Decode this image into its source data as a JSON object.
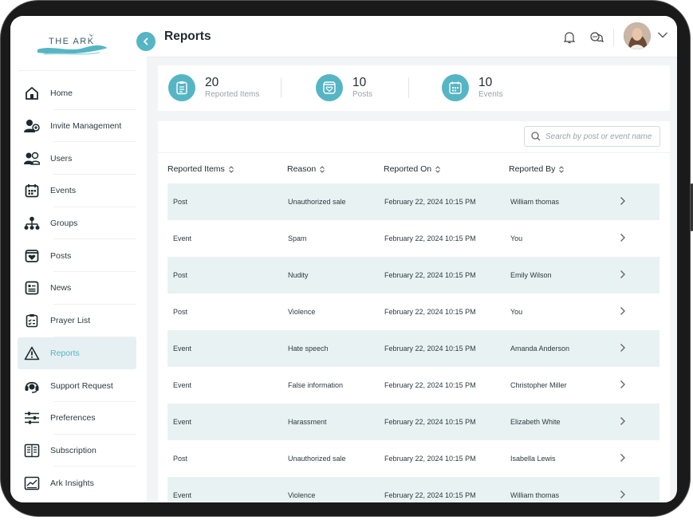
{
  "brand": {
    "logo_text": "THE ARK"
  },
  "sidebar": {
    "items": [
      {
        "label": "Home",
        "icon": "home-icon"
      },
      {
        "label": "Invite Management",
        "icon": "invite-user-icon"
      },
      {
        "label": "Users",
        "icon": "users-icon"
      },
      {
        "label": "Events",
        "icon": "calendar-icon"
      },
      {
        "label": "Groups",
        "icon": "groups-icon"
      },
      {
        "label": "Posts",
        "icon": "post-heart-icon"
      },
      {
        "label": "News",
        "icon": "news-icon"
      },
      {
        "label": "Prayer List",
        "icon": "clipboard-list-icon"
      },
      {
        "label": "Reports",
        "icon": "warning-icon",
        "active": true
      },
      {
        "label": "Support Request",
        "icon": "headset-icon"
      },
      {
        "label": "Preferences",
        "icon": "sliders-icon"
      },
      {
        "label": "Subscription",
        "icon": "subscription-book-icon"
      },
      {
        "label": "Ark Insights",
        "icon": "insights-chart-icon"
      }
    ]
  },
  "header": {
    "title": "Reports"
  },
  "stats": [
    {
      "value": "20",
      "label": "Reported Items",
      "icon": "clipboard-icon"
    },
    {
      "value": "10",
      "label": "Posts",
      "icon": "post-heart-icon"
    },
    {
      "value": "10",
      "label": "Events",
      "icon": "calendar-icon"
    }
  ],
  "search": {
    "placeholder": "Search by post or event name"
  },
  "table": {
    "columns": [
      "Reported Items",
      "Reason",
      "Reported On",
      "Reported By"
    ],
    "rows": [
      [
        "Post",
        "Unauthorized sale",
        "February 22, 2024 10:15 PM",
        "William thomas"
      ],
      [
        "Event",
        "Spam",
        "February 22, 2024 10:15 PM",
        "You"
      ],
      [
        "Post",
        "Nudity",
        "February 22, 2024 10:15 PM",
        "Emily Wilson"
      ],
      [
        "Post",
        "Violence",
        "February 22, 2024 10:15 PM",
        "You"
      ],
      [
        "Event",
        "Hate speech",
        "February 22, 2024 10:15 PM",
        "Amanda Anderson"
      ],
      [
        "Event",
        "False information",
        "February 22, 2024 10:15 PM",
        "Christopher Miller"
      ],
      [
        "Event",
        "Harassment",
        "February 22, 2024 10:15 PM",
        "Elizabeth White"
      ],
      [
        "Post",
        "Unauthorized sale",
        "February 22, 2024 10:15 PM",
        "Isabella Lewis"
      ],
      [
        "Event",
        "Violence",
        "February 22, 2024 10:15 PM",
        "William thomas"
      ]
    ]
  },
  "colors": {
    "accent": "#56b5c4",
    "stripe": "#e9f2f3",
    "active_bg": "#e6f0f2"
  }
}
